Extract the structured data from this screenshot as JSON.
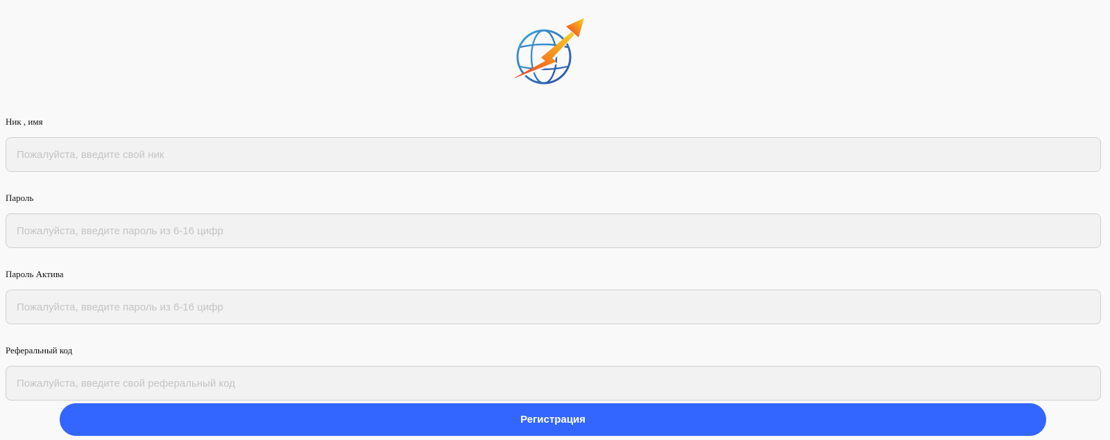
{
  "logo": {
    "icon": "globe-arrow-logo-icon"
  },
  "form": {
    "fields": [
      {
        "label": "Ник , имя",
        "placeholder": "Пожалуйста, введите свой ник",
        "value": ""
      },
      {
        "label": "Пароль",
        "placeholder": "Пожалуйста, введите пароль из 6-16 цифр",
        "value": ""
      },
      {
        "label": "Пароль Актива",
        "placeholder": "Пожалуйста, введите пароль из 6-16 цифр",
        "value": ""
      },
      {
        "label": "Реферальный код",
        "placeholder": "Пожалуйста, введите свой реферальный код",
        "value": ""
      }
    ],
    "submit_label": "Регистрация"
  },
  "colors": {
    "background": "#f9f9f9",
    "input_bg": "#f2f2f2",
    "input_border": "#cfcfcf",
    "placeholder": "#c4c4c4",
    "button": "#3366ff",
    "button_text": "#ffffff"
  }
}
